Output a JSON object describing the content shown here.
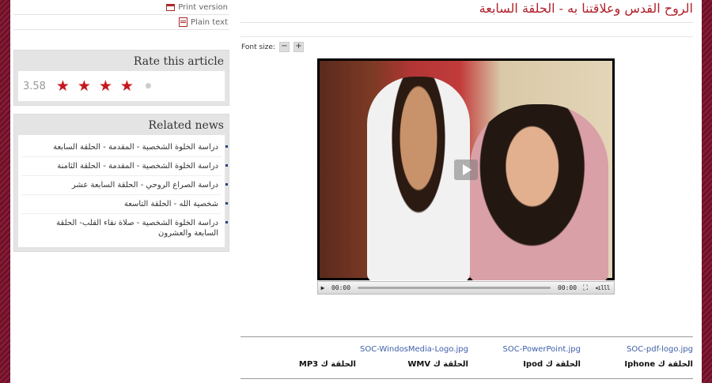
{
  "toolbar": {
    "print_label": "Print version",
    "plain_label": "Plain text"
  },
  "rating": {
    "title": "Rate this article",
    "score": "3.58",
    "stars_value": 3.58,
    "stars_max": 5
  },
  "related": {
    "title": "Related news",
    "items": [
      "دراسة الخلوة الشخصية - المقدمة - الحلقة السابعة",
      "دراسة الخلوة الشخصية - المقدمة - الحلقة الثامنة",
      "دراسة الصراع الروحي - الحلقة السابعة عشر",
      "شخصية الله - الحلقة التاسعة",
      "دراسة الخلوة الشخصية - صلاة نقاء القلب- الحلقة السابعة والعشرون"
    ]
  },
  "article": {
    "title": "الروح القدس وعلاقتنا به - الحلقة السابعة",
    "font_size_label": "Font size:",
    "font_decrease": "−",
    "font_increase": "+"
  },
  "player": {
    "time_current": "00:00",
    "time_total": "00:00",
    "progress": 0
  },
  "downloads": [
    {
      "file": "SOC-pdf-logo.jpg",
      "label": "الحلقة ك Iphone"
    },
    {
      "file": "SOC-PowerPoint.jpg",
      "label": "الحلقة ك Ipod"
    },
    {
      "file": "SOC-WindosMedia-Logo.jpg",
      "label": "الحلقة ك WMV"
    },
    {
      "file": "",
      "label": "الحلقة ك MP3"
    }
  ],
  "colors": {
    "accent": "#c8161d",
    "link": "#3d5fa8",
    "background": "#7a1630"
  }
}
